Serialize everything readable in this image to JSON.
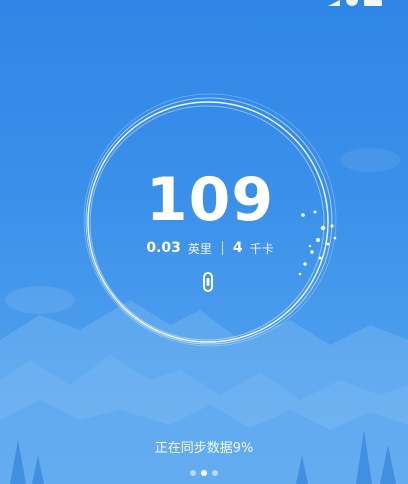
{
  "dashboard": {
    "step_count": "109",
    "distance_value": "0.03",
    "distance_unit": "英里",
    "calories_value": "4",
    "calories_unit": "千卡"
  },
  "sync": {
    "status_text": "正在同步数据9%",
    "progress_percent": 9
  },
  "pager": {
    "page_count": 3,
    "active_page": 2
  },
  "icons": {
    "device": "fitness-band-icon",
    "status_bar": [
      "signal-icon",
      "wifi-icon",
      "battery-icon"
    ]
  },
  "colors": {
    "background_top": "#2f86e6",
    "background_bottom": "#5aa6ef",
    "ring": "#ffffff",
    "mountains": "#6fb3f2"
  }
}
